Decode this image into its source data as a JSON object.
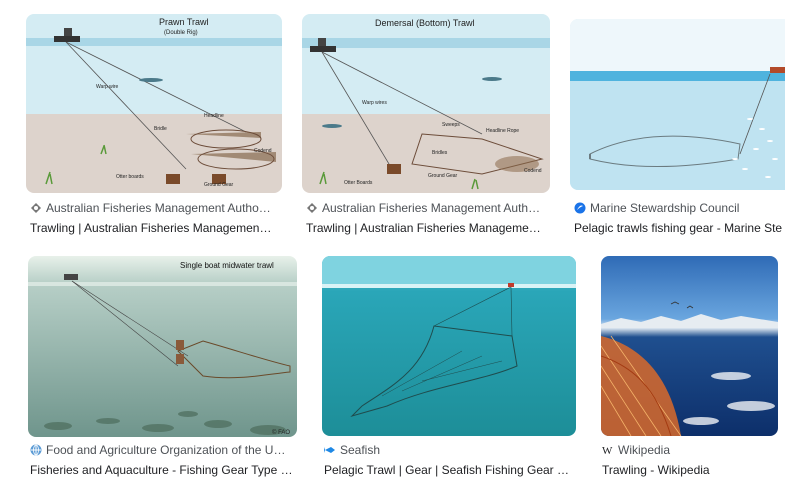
{
  "results": [
    {
      "image_title": "Prawn Trawl",
      "image_subtitle": "(Double Rig)",
      "diagram_labels": [
        "Warp wire",
        "Headline",
        "Bridle",
        "Codend",
        "Otter boards",
        "Ground Gear"
      ],
      "source": "Australian Fisheries Management Autho…",
      "title": "Trawling | Australian Fisheries Managemen…"
    },
    {
      "image_title": "Demersal (Bottom) Trawl",
      "diagram_labels": [
        "Warp wires",
        "Sweeps",
        "Headline Rope",
        "Bridles",
        "Ground Gear",
        "Otter Boards",
        "Codend"
      ],
      "source": "Australian Fisheries Management Auth…",
      "title": "Trawling | Australian Fisheries Manageme…"
    },
    {
      "source": "Marine Stewardship Council",
      "title": "Pelagic trawls fishing gear - Marine Ste"
    },
    {
      "image_title": "Single boat midwater trawl",
      "image_credit": "© FAO",
      "source": "Food and Agriculture Organization of the U…",
      "title": "Fisheries and Aquaculture - Fishing Gear Type …"
    },
    {
      "source": "Seafish",
      "title": "Pelagic Trawl | Gear | Seafish Fishing Gear …"
    },
    {
      "source": "Wikipedia",
      "title": "Trawling - Wikipedia"
    }
  ],
  "colors": {
    "source_text": "#4d5156",
    "title_text": "#202124",
    "msc_blue": "#1a73e8",
    "seafish_blue": "#1e88e5"
  },
  "icons": [
    "crest-icon",
    "crest-icon",
    "msc-logo-icon",
    "fao-globe-icon",
    "seafish-logo-icon",
    "wikipedia-w-icon"
  ]
}
